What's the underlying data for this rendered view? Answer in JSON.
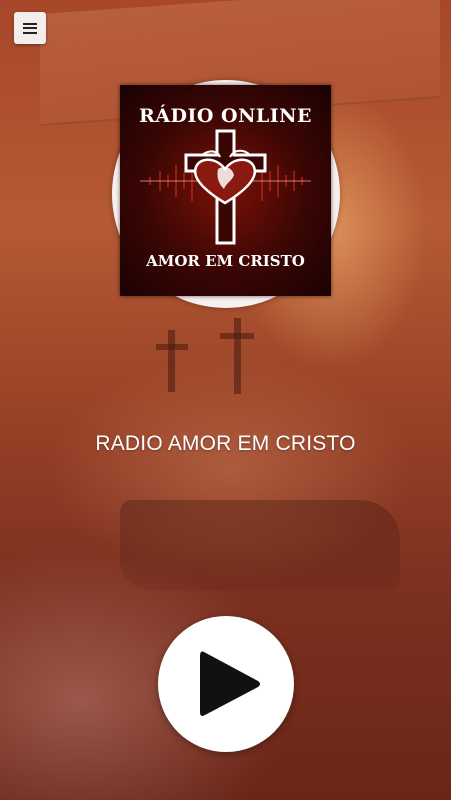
{
  "header": {
    "menu_icon": "hamburger-icon"
  },
  "logo": {
    "title": "RÁDIO ONLINE",
    "subtitle": "AMOR EM CRISTO"
  },
  "station": {
    "name": "RADIO AMOR EM CRISTO"
  },
  "player": {
    "play_icon": "play-icon",
    "state": "stopped"
  },
  "colors": {
    "background_primary": "#a8472a",
    "logo_red": "#7a1208",
    "button_white": "#ffffff"
  }
}
